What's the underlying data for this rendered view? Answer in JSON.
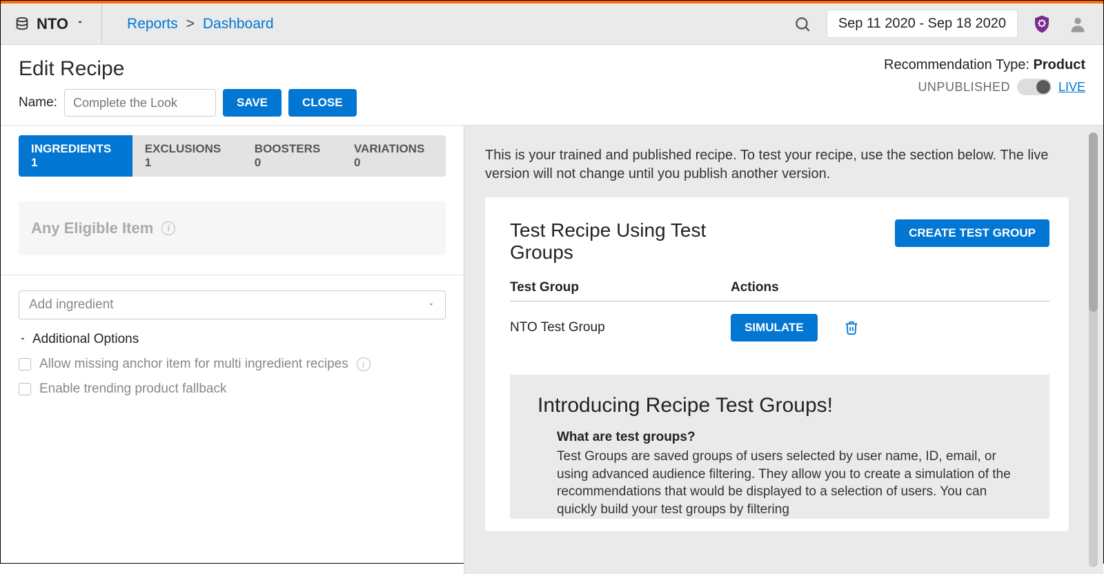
{
  "topbar": {
    "org_name": "NTO",
    "breadcrumb": {
      "item1": "Reports",
      "separator": ">",
      "item2": "Dashboard"
    },
    "date_range": "Sep 11 2020 - Sep 18 2020"
  },
  "subheader": {
    "page_title": "Edit Recipe",
    "name_label": "Name:",
    "name_placeholder": "Complete the Look",
    "save_label": "SAVE",
    "close_label": "CLOSE",
    "rec_type_label": "Recommendation Type: ",
    "rec_type_value": "Product",
    "unpublished_label": "UNPUBLISHED",
    "live_label": "LIVE"
  },
  "tabs": [
    {
      "label": "INGREDIENTS 1"
    },
    {
      "label": "EXCLUSIONS 1"
    },
    {
      "label": "BOOSTERS 0"
    },
    {
      "label": "VARIATIONS 0"
    }
  ],
  "left": {
    "eligible_item": "Any Eligible Item",
    "add_ingredient_placeholder": "Add ingredient",
    "additional_options": "Additional Options",
    "chk1": "Allow missing anchor item for multi ingredient recipes",
    "chk2": "Enable trending product fallback"
  },
  "right": {
    "desc": "This is your trained and published recipe. To test your recipe, use the section below. The live version will not change until you publish another version.",
    "card_title": "Test Recipe Using Test Groups",
    "create_btn": "CREATE TEST GROUP",
    "col1": "Test Group",
    "col2": "Actions",
    "row1_name": "NTO Test Group",
    "simulate": "SIMULATE",
    "intro_title": "Introducing Recipe Test Groups!",
    "intro_sub": "What are test groups?",
    "intro_body": "Test Groups are saved groups of users selected by user name, ID, email, or using advanced audience filtering. They allow you to create a simulation of the recommendations that would be displayed to a selection of users. You can quickly build your test groups by filtering"
  }
}
